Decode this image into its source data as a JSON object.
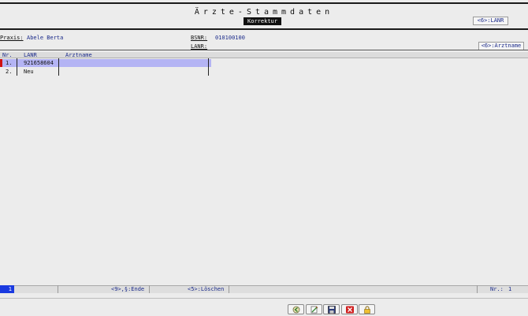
{
  "header": {
    "title": "Ärzte-Stammdaten",
    "mode": "Korrektur",
    "lanr_key": "<6>:LANR",
    "arztname_key": "<6>:Arztname"
  },
  "info": {
    "praxis_label": "Praxis:",
    "praxis_value": "Abele Berta",
    "bsnr_label": "BSNR:",
    "bsnr_value": "010100100",
    "lanr_label": "LANR:",
    "lanr_value": ""
  },
  "table": {
    "columns": [
      "Nr.",
      "LANR",
      "Arztname"
    ],
    "rows": [
      {
        "nr": "1.",
        "lanr": "921658604",
        "arztname": ""
      },
      {
        "nr": "2.",
        "lanr": "Neu",
        "arztname": ""
      }
    ]
  },
  "status": {
    "current": "1",
    "end_key": "<9>,§:Ende",
    "delete_key": "<5>:Löschen",
    "nr_label": "Nr.:",
    "nr_value": "1"
  },
  "toolbar": {
    "icons": [
      "back-icon",
      "edit-icon",
      "save-icon",
      "cancel-icon",
      "lock-icon"
    ]
  }
}
